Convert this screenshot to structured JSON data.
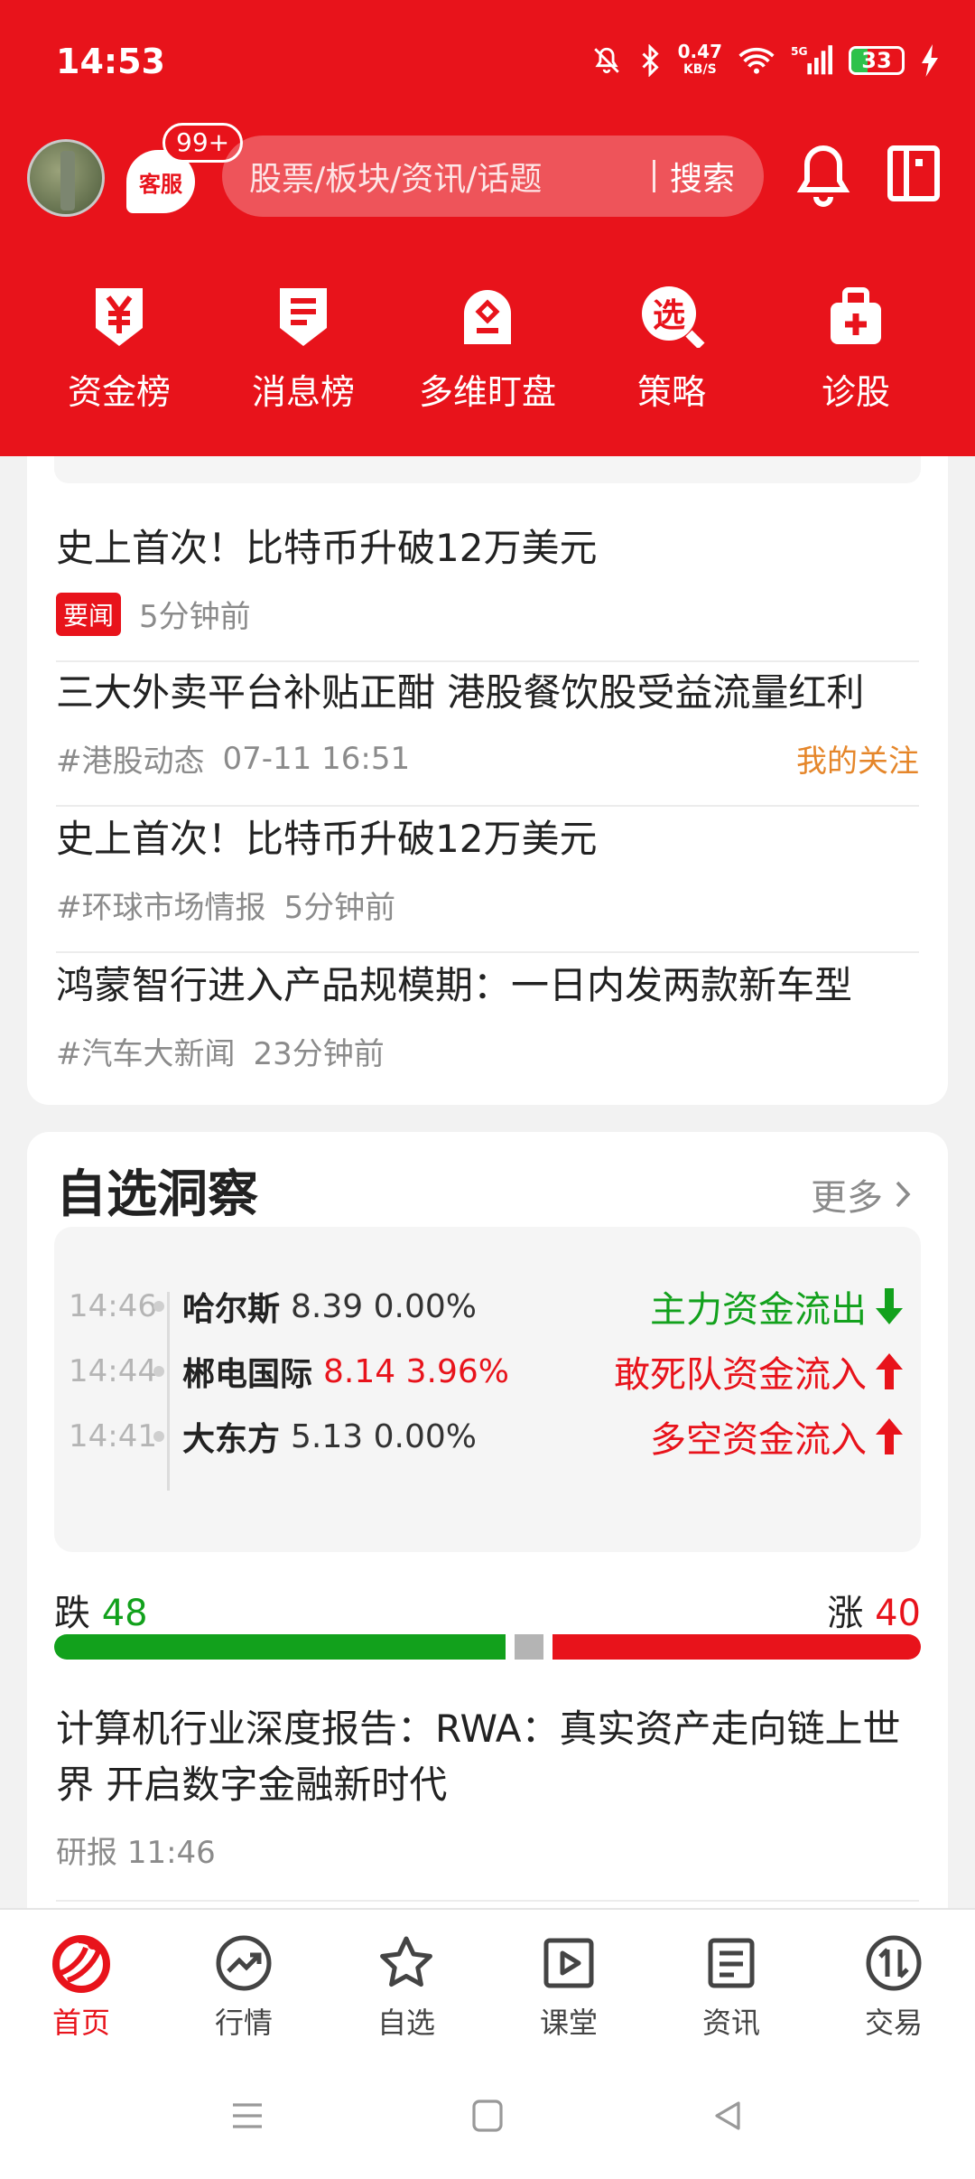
{
  "status_bar": {
    "time": "14:53",
    "net_speed": "0.47",
    "net_unit": "KB/S",
    "signal": "5G",
    "battery": "33"
  },
  "header": {
    "kefu_label": "客服",
    "kefu_badge": "99+",
    "search": {
      "placeholder": "股票/板块/资讯/话题",
      "button": "搜索"
    },
    "quick_nav": [
      {
        "label": "资金榜",
        "icon": "yen-shield-icon"
      },
      {
        "label": "消息榜",
        "icon": "message-shield-icon"
      },
      {
        "label": "多维盯盘",
        "icon": "home-watch-icon"
      },
      {
        "label": "策略",
        "icon": "strategy-select-icon"
      },
      {
        "label": "诊股",
        "icon": "medical-bag-icon"
      }
    ]
  },
  "news": [
    {
      "title": "史上首次！比特币升破12万美元",
      "tag": "要闻",
      "time": "5分钟前"
    },
    {
      "title": "三大外卖平台补贴正酣 港股餐饮股受益流量红利",
      "topic": "#港股动态",
      "time": "07-11 16:51",
      "follow": "我的关注"
    },
    {
      "title": "史上首次！比特币升破12万美元",
      "topic": "#环球市场情报",
      "time": "5分钟前"
    },
    {
      "title": "鸿蒙智行进入产品规模期：一日内发两款新车型",
      "topic": "#汽车大新闻",
      "time": "23分钟前"
    }
  ],
  "watch": {
    "title": "自选洞察",
    "more": "更多",
    "insights": [
      {
        "time": "14:46",
        "name": "哈尔斯",
        "price": "8.39 0.00%",
        "direction": "flat",
        "signal": "主力资金流出",
        "signal_dir": "out"
      },
      {
        "time": "14:44",
        "name": "郴电国际",
        "price": "8.14 3.96%",
        "direction": "up",
        "signal": "敢死队资金流入",
        "signal_dir": "in"
      },
      {
        "time": "14:41",
        "name": "大东方",
        "price": "5.13 0.00%",
        "direction": "flat",
        "signal": "多空资金流入",
        "signal_dir": "in"
      }
    ],
    "down_label": "跌",
    "down_count": "48",
    "up_label": "涨",
    "up_count": "40",
    "report": {
      "title": "计算机行业深度报告：RWA：真实资产走向链上世界 开启数字金融新时代",
      "source": "研报",
      "time": "11:46"
    }
  },
  "bottom_nav": [
    {
      "label": "首页",
      "icon": "home-logo-icon",
      "active": true
    },
    {
      "label": "行情",
      "icon": "market-trend-icon",
      "active": false
    },
    {
      "label": "自选",
      "icon": "star-icon",
      "active": false
    },
    {
      "label": "课堂",
      "icon": "play-video-icon",
      "active": false
    },
    {
      "label": "资讯",
      "icon": "news-doc-icon",
      "active": false
    },
    {
      "label": "交易",
      "icon": "trade-exchange-icon",
      "active": false
    }
  ],
  "colors": {
    "brand_red": "#e8131b",
    "rise": "#e8131b",
    "fall": "#12a11c",
    "follow": "#e5862a"
  }
}
